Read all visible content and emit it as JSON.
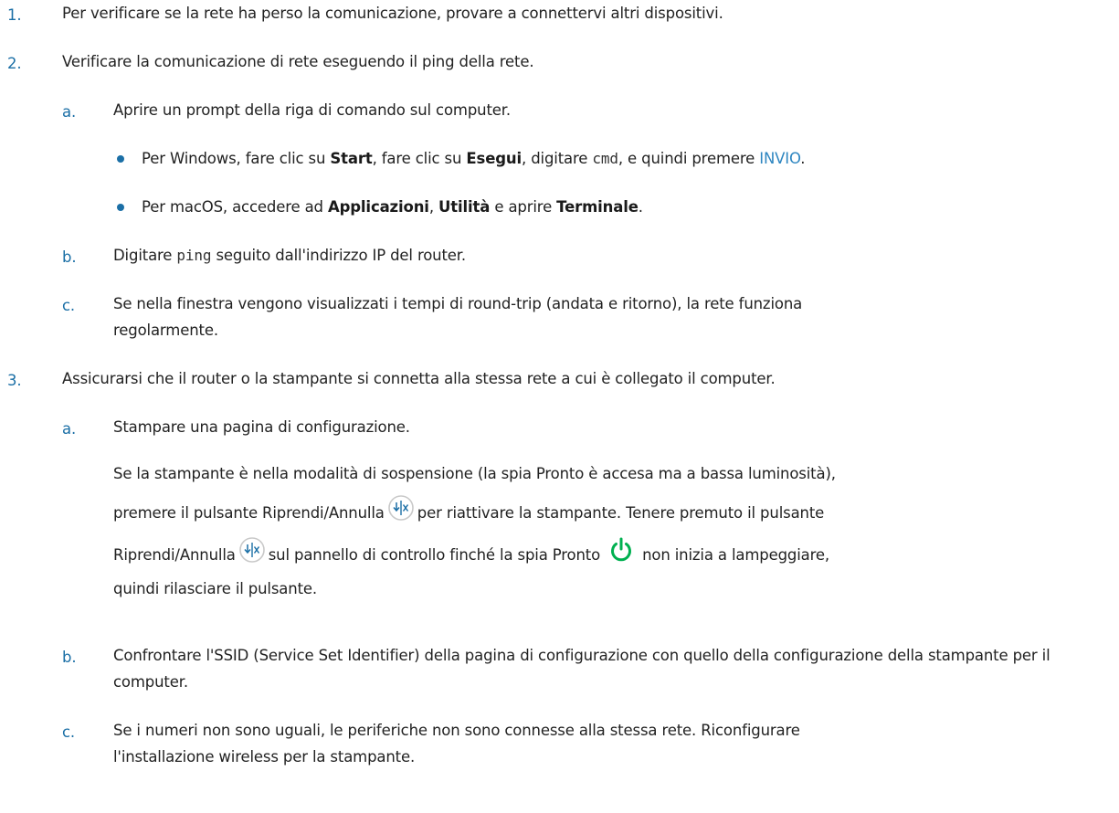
{
  "steps": [
    {
      "number": "1.",
      "text": "Per verificare se la rete ha perso la comunicazione, provare a connettervi altri dispositivi."
    },
    {
      "number": "2.",
      "text": "Verificare la comunicazione di rete eseguendo il ping della rete.",
      "substeps": [
        {
          "letter": "a.",
          "text": "Aprire un prompt della riga di comando sul computer.",
          "bullets": [
            {
              "t1": "Per Windows, fare clic su ",
              "b1": "Start",
              "t2": ", fare clic su ",
              "b2": "Esegui",
              "t3": ", digitare ",
              "code": "cmd",
              "t4": ", e quindi premere ",
              "link": "INVIO",
              "t5": "."
            },
            {
              "t1": "Per macOS, accedere ad ",
              "b1": "Applicazioni",
              "t2": ", ",
              "b2": "Utilità",
              "t3": " e aprire ",
              "b3": "Terminale",
              "t4": "."
            }
          ]
        },
        {
          "letter": "b.",
          "t1": "Digitare ",
          "code": "ping",
          "t2": " seguito dall'indirizzo IP del router."
        },
        {
          "letter": "c.",
          "text": "Se nella finestra vengono visualizzati i tempi di round-trip (andata e ritorno), la rete funziona regolarmente."
        }
      ]
    },
    {
      "number": "3.",
      "text": "Assicurarsi che il router o la stampante si connetta alla stessa rete a cui è collegato il computer.",
      "substeps": [
        {
          "letter": "a.",
          "text": "Stampare una pagina di configurazione.",
          "note": {
            "p1": "Se la stampante è nella modalità di sospensione (la spia Pronto è accesa ma a bassa luminosità),",
            "p2": "premere il pulsante Riprendi/Annulla",
            "p3": "per riattivare la stampante. Tenere premuto il pulsante",
            "p4": "Riprendi/Annulla",
            "p5": "sul pannello di controllo finché la spia Pronto",
            "p6": "non inizia a lampeggiare,",
            "p7": "quindi rilasciare il pulsante."
          }
        },
        {
          "letter": "b.",
          "text": "Confrontare l'SSID (Service Set Identifier) della pagina di configurazione con quello della configurazione della stampante per il computer."
        },
        {
          "letter": "c.",
          "text": "Se i numeri non sono uguali, le periferiche non sono connesse alla stessa rete. Riconfigurare l'installazione wireless per la stampante."
        }
      ]
    }
  ],
  "icons": {
    "resume_cancel": "resume-cancel-icon",
    "power": "power-icon",
    "accent_color": "#1b6fa6",
    "power_color": "#00b050"
  }
}
